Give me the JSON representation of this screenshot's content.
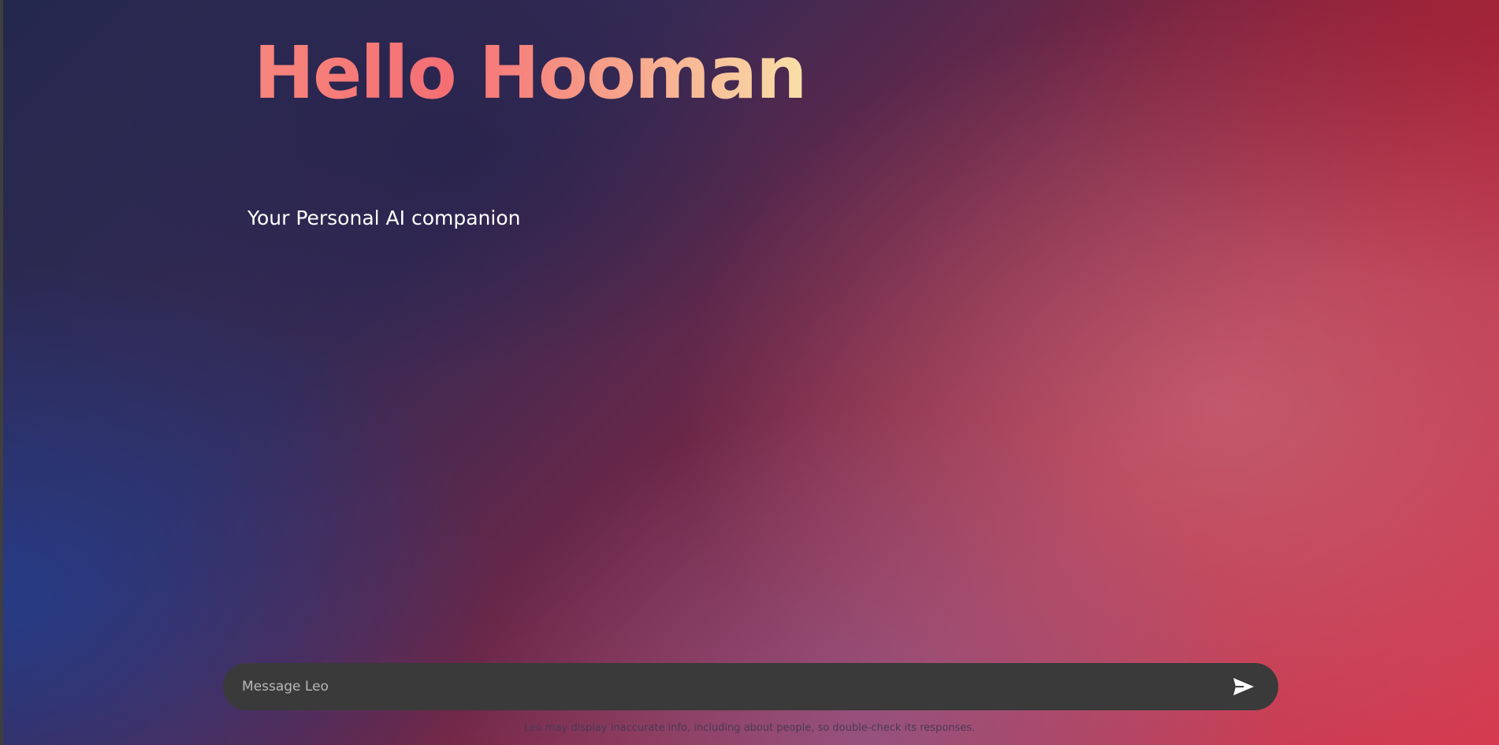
{
  "hero": {
    "title": "Hello Hooman",
    "subtitle": "Your Personal AI companion"
  },
  "composer": {
    "placeholder": "Message Leo",
    "value": "",
    "send_icon": "send-icon"
  },
  "footer": {
    "disclaimer": "Leo may display inaccurate info, including about people, so double-check its responses."
  },
  "colors": {
    "title_gradient": [
      "#f7857c",
      "#f46f74",
      "#f7a08a",
      "#f9e0a8"
    ],
    "composer_bg": "#3a3a3a",
    "subtitle": "#ffffff",
    "send_icon": "#ffffff"
  }
}
